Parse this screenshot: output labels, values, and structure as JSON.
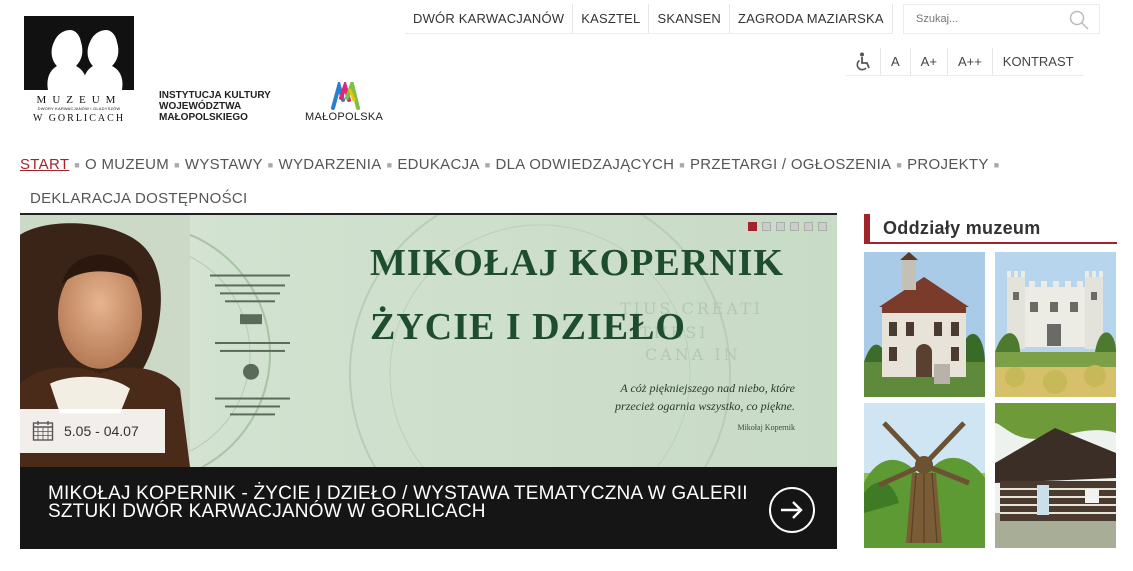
{
  "logo": {
    "line1": "MUZEUM",
    "line2": "DWORY KARWACJANÓW I GLADYSZÓW",
    "line3": "W GORLICACH"
  },
  "institution": {
    "line1": "INSTYTUCJA KULTURY",
    "line2": "WOJEWÓDZTWA",
    "line3": "MAŁOPOLSKIEGO"
  },
  "malopolska": {
    "label": "MAŁOPOLSKA"
  },
  "top_nav": [
    "DWÓR KARWACJANÓW",
    "KASZTEL",
    "SKANSEN",
    "ZAGRODA MAZIARSKA"
  ],
  "search": {
    "placeholder": "Szukaj..."
  },
  "accessibility": {
    "font_normal": "A",
    "font_large": "A+",
    "font_xlarge": "A++",
    "contrast": "KONTRAST"
  },
  "main_nav": [
    {
      "label": "START",
      "active": true
    },
    {
      "label": "O MUZEUM"
    },
    {
      "label": "WYSTAWY"
    },
    {
      "label": "WYDARZENIA"
    },
    {
      "label": "EDUKACJA"
    },
    {
      "label": "DLA ODWIEDZAJĄCYCH"
    },
    {
      "label": "PRZETARGI / OGŁOSZENIA"
    },
    {
      "label": "PROJEKTY"
    },
    {
      "label": "DEKLARACJA DOSTĘPNOŚCI"
    }
  ],
  "slider": {
    "title_line1": "MIKOŁAJ KOPERNIK",
    "title_line2": "ŻYCIE I DZIEŁO",
    "quote": "A cóż piękniejszego nad niebo, które przecież ogarnia wszystko, co piękne.",
    "quote_author": "Mikołaj Kopernik",
    "date": "5.05 - 04.07",
    "caption": "MIKOŁAJ KOPERNIK - ŻYCIE I DZIEŁO / WYSTAWA TEMATYCZNA W GALERII SZTUKI DWÓR KARWACJANÓW W GORLICACH",
    "dots": 6,
    "active_dot": 0
  },
  "sidebar": {
    "heading": "Oddziały muzeum"
  },
  "colors": {
    "accent": "#a3232b",
    "caption_bg": "#151515",
    "slide_green": "#1e4d2e"
  }
}
